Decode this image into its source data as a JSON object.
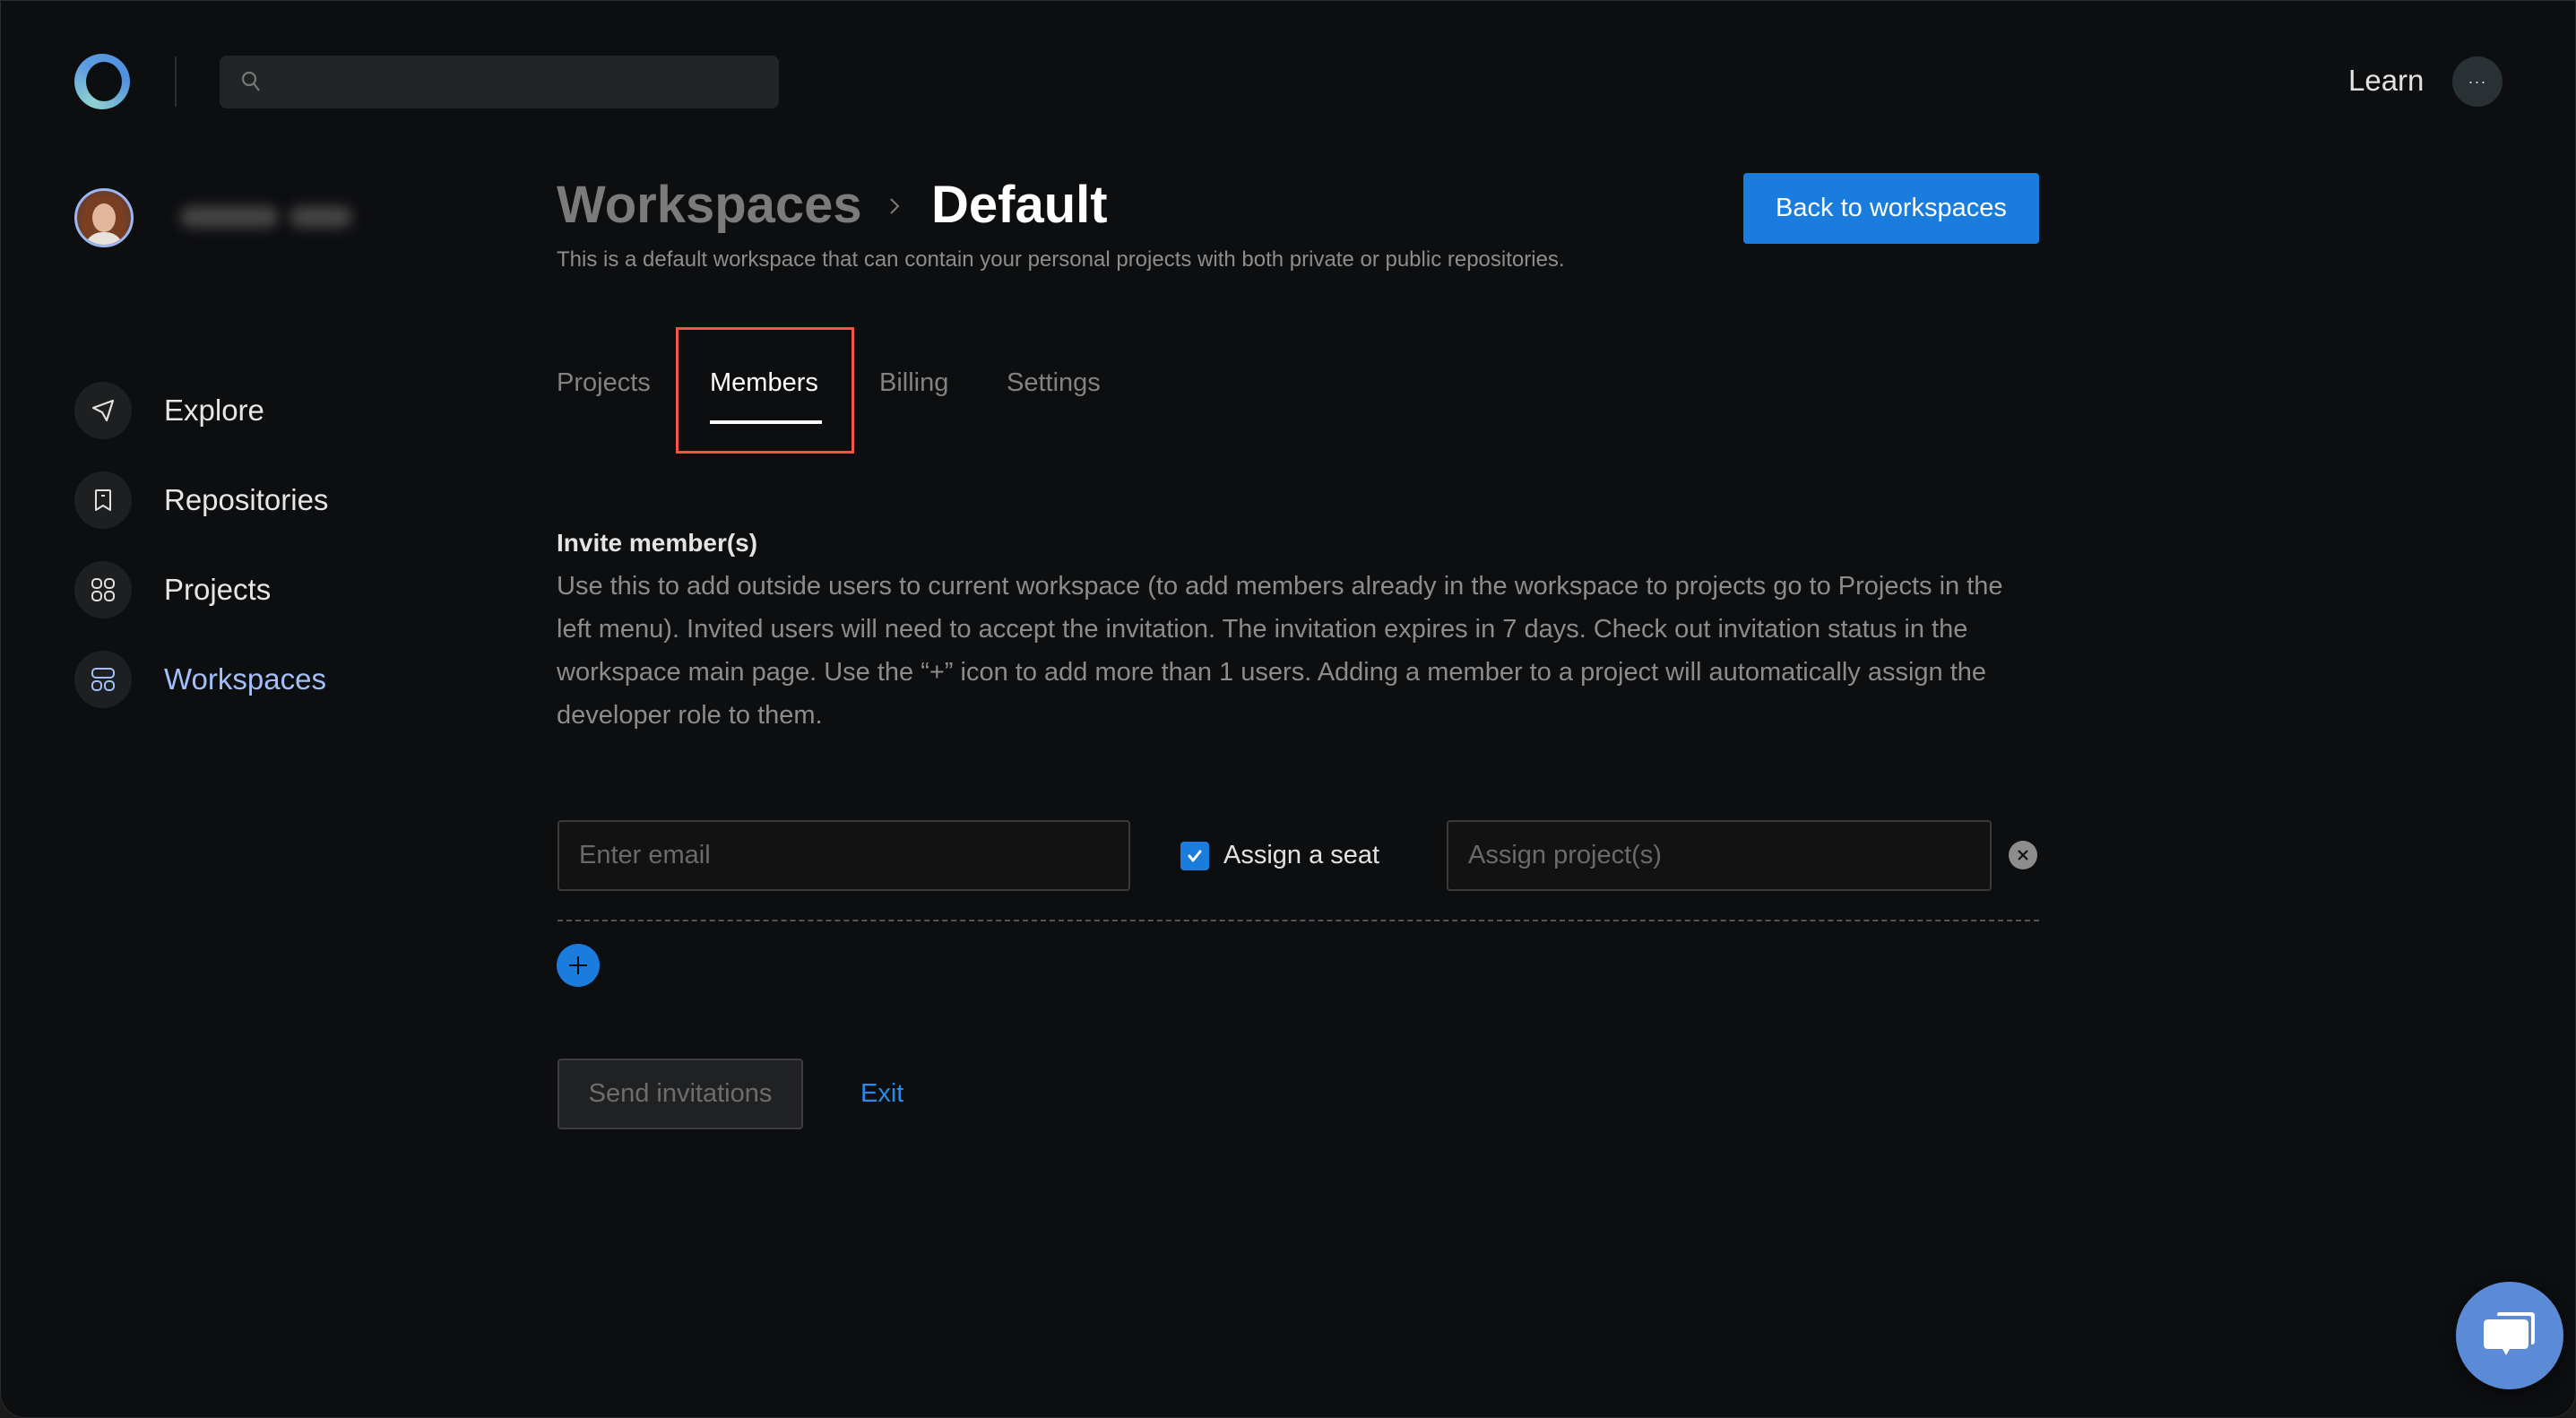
{
  "topbar": {
    "logo": "app-logo-ring",
    "search": {
      "placeholder": "",
      "value": "",
      "icon": "search-icon"
    },
    "learn_label": "Learn",
    "more_label": "···"
  },
  "sidebar": {
    "user": {
      "avatar": "user-avatar-photo",
      "name_blurred": true
    },
    "items": [
      {
        "label": "Explore",
        "icon": "paper-plane-icon",
        "active": false
      },
      {
        "label": "Repositories",
        "icon": "bookmark-icon",
        "active": false
      },
      {
        "label": "Projects",
        "icon": "grid-icon",
        "active": false
      },
      {
        "label": "Workspaces",
        "icon": "layout-icon",
        "active": true
      }
    ]
  },
  "header": {
    "breadcrumb_parent": "Workspaces",
    "breadcrumb_separator": "›",
    "breadcrumb_current": "Default",
    "description": "This is a default workspace that can contain your personal projects with both private or public repositories.",
    "back_button_label": "Back to workspaces"
  },
  "tabs": [
    {
      "label": "Projects",
      "active": false
    },
    {
      "label": "Members",
      "active": true
    },
    {
      "label": "Billing",
      "active": false
    },
    {
      "label": "Settings",
      "active": false
    }
  ],
  "invite": {
    "title": "Invite member(s)",
    "body": "Use this to add outside users to current workspace (to add members already in the workspace to projects go to Projects in the left menu). Invited users will need to accept the invitation. The invitation expires in 7 days. Check out invitation status in the workspace main page. Use the “+” icon to add more than 1 users. Adding a member to a project will automatically assign the developer role to them.",
    "rows": [
      {
        "email_placeholder": "Enter email",
        "email_value": "",
        "assign_seat_label": "Assign a seat",
        "assign_seat_checked": true,
        "project_placeholder": "Assign project(s)",
        "project_value": ""
      }
    ],
    "send_button_label": "Send invitations",
    "send_button_disabled": true,
    "exit_label": "Exit"
  },
  "colors": {
    "accent": "#1a7ddd",
    "active_nav": "#a3bffa",
    "highlight": "#f05545",
    "background": "#0d0e10",
    "chat": "#5b8bd6"
  },
  "chat_widget": {
    "icon": "chat-bubbles-icon"
  }
}
